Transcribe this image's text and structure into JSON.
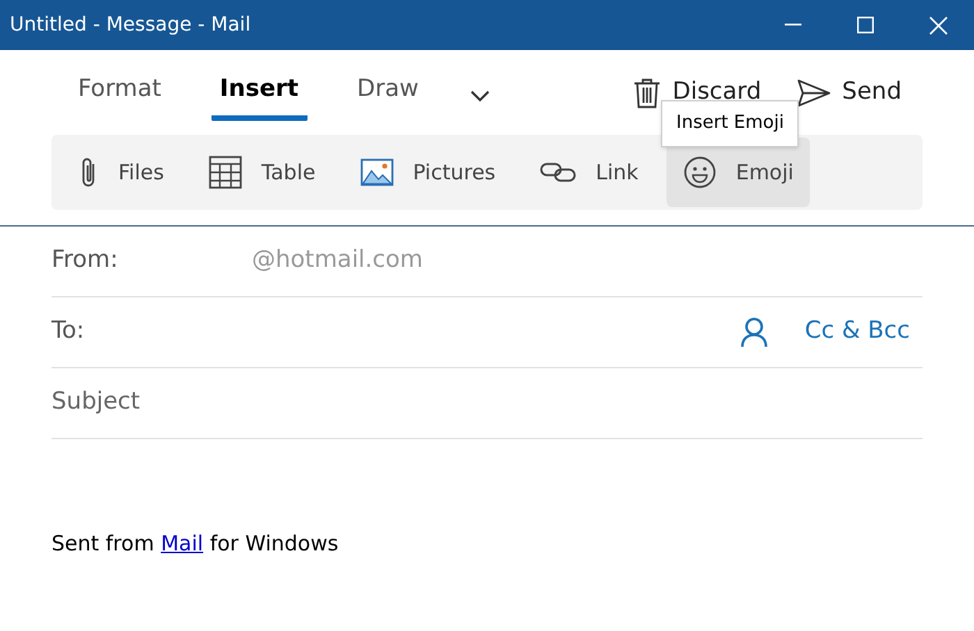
{
  "window": {
    "title": "Untitled - Message - Mail"
  },
  "tabs": [
    {
      "label": "Format",
      "selected": false
    },
    {
      "label": "Insert",
      "selected": true
    },
    {
      "label": "Draw",
      "selected": false
    }
  ],
  "actions": [
    {
      "kind": "discard",
      "label": "Discard"
    },
    {
      "kind": "send",
      "label": "Send"
    }
  ],
  "toolbar": [
    {
      "kind": "files",
      "label": "Files",
      "selected": false
    },
    {
      "kind": "table",
      "label": "Table",
      "selected": false
    },
    {
      "kind": "pictures",
      "label": "Pictures",
      "selected": false
    },
    {
      "kind": "link",
      "label": "Link",
      "selected": false
    },
    {
      "kind": "emoji",
      "label": "Emoji",
      "selected": true
    }
  ],
  "tooltip": "Insert Emoji",
  "from": {
    "label": "From:",
    "value": "@hotmail.com"
  },
  "to": {
    "label": "To:",
    "cc_bcc": "Cc & Bcc"
  },
  "subject": {
    "placeholder": "Subject"
  },
  "signature": {
    "before": "Sent from ",
    "link": "Mail",
    "after": " for Windows"
  }
}
